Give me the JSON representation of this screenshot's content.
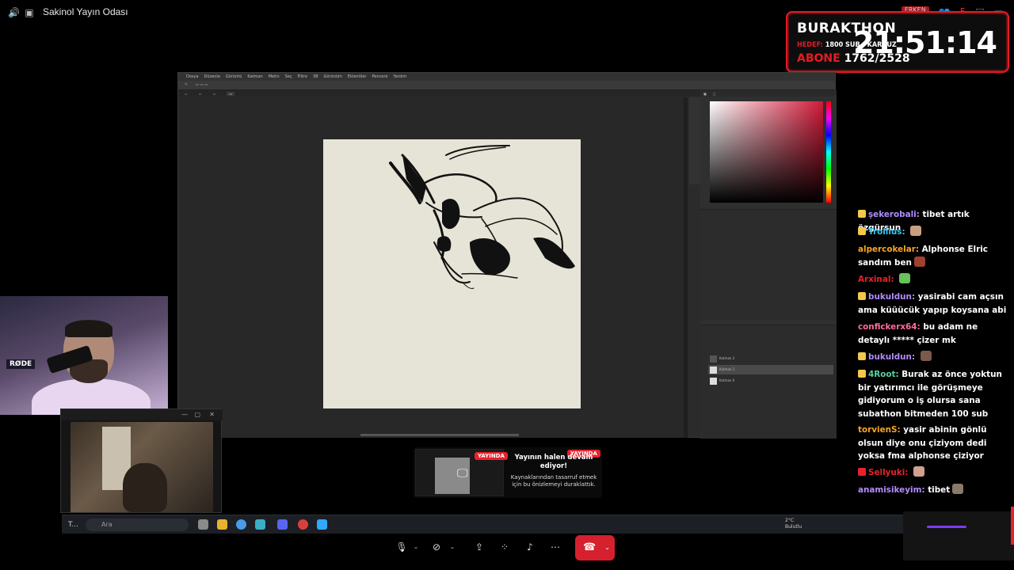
{
  "topbar": {
    "room_title": "Sakinol Yayın Odası",
    "right_badge": "ERKEN",
    "right_count": "5"
  },
  "subathon": {
    "name": "BURAKTHON",
    "hedef_label": "HEDEF:",
    "hedef_text": "1800 SUB - KARPUZ",
    "abone_label": "ABONE",
    "abone_value": "1762/2528",
    "timer": "21:51:14",
    "accent": "#e41c25"
  },
  "cam1": {
    "mic_label": "RØDE"
  },
  "taskbar": {
    "search_placeholder": "Ara",
    "weather_temp": "2°C",
    "weather_desc": "Bulutlu",
    "start_label": "T..."
  },
  "paused_preview": {
    "badge": "YAYINDA",
    "title": "Yayının halen devam ediyor!",
    "description": "Kaynaklarından tasarruf etmek için bu önizlemeyi duraklattık."
  },
  "chat": [
    {
      "user": "şekerobali",
      "text": "tibet artık özgürsun",
      "color": "#b18cff",
      "badge": "#f2c94c"
    },
    {
      "user": "Trollius",
      "text": "",
      "color": "#3ac4e8",
      "badge": "#f2c94c",
      "emote": "#c8a080"
    },
    {
      "user": "alpercokelar",
      "text": "Alphonse Elric sandım ben",
      "color": "#f5a623",
      "badge": "",
      "emote": "#a04030"
    },
    {
      "user": "Arxinal",
      "text": "",
      "color": "#e8222c",
      "badge": "",
      "emote": "#6ac25a"
    },
    {
      "user": "bukuldun",
      "text": "yasirabi cam açsın ama küüücük yapıp koysana abi",
      "color": "#b18cff",
      "badge": "#f2c94c"
    },
    {
      "user": "confickerx64",
      "text": "bu adam ne detaylı ***** çizer mk",
      "color": "#ff6b9d",
      "badge": ""
    },
    {
      "user": "bukuldun",
      "text": "",
      "color": "#b18cff",
      "badge": "#f2c94c",
      "emote": "#7a5a4a"
    },
    {
      "user": "4Root",
      "text": "Burak az önce yoktun bir yatırımcı ile görüşmeye gidiyorum o iş olursa sana subathon bitmeden 100 sub",
      "color": "#5ad0a0",
      "badge": "#f2c94c"
    },
    {
      "user": "torvienS",
      "text": "yasir abinin gönlü olsun diye onu çiziyom dedi yoksa fma alphonse çiziyor",
      "color": "#f5a623",
      "badge": ""
    },
    {
      "user": "Sellyuki",
      "text": "",
      "color": "#e8222c",
      "badge": "#e8222c",
      "emote": "#d0a090"
    },
    {
      "user": "anamisikeyim",
      "text": "tibet",
      "color": "#b18cff",
      "badge": "",
      "emote": "#8a7a6a"
    }
  ],
  "photoshop": {
    "menu": [
      "Dosya",
      "Düzenle",
      "Görüntü",
      "Katman",
      "Metin",
      "Seç",
      "Filtre",
      "3B",
      "Görünüm",
      "Eklentiler",
      "Pencere",
      "Yardım"
    ],
    "layers": [
      "Katman 2",
      "Katman 1",
      "Katman 0"
    ]
  }
}
